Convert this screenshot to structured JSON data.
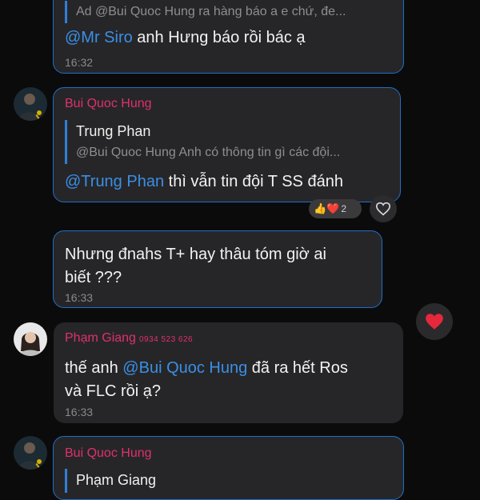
{
  "messages": [
    {
      "quote_text": "Ad @Bui Quoc Hung  ra hàng báo a e chứ, đe...",
      "mention": "@Mr Siro",
      "text": " anh Hưng báo rồi bác ạ",
      "time": "16:32"
    },
    {
      "sender": "Bui Quoc Hung",
      "quote_name": "Trung Phan",
      "quote_text": "@Bui Quoc Hung Anh có thông tin gì các đội...",
      "mention": "@Trung Phan",
      "text": " thì vẫn tin đội T SS đánh",
      "reactions": {
        "emojis": "👍❤️",
        "count": "2"
      }
    },
    {
      "line1": "Nhưng đnahs T+ hay thâu tóm giờ ai",
      "line2": "biết ???",
      "time": "16:33"
    },
    {
      "sender": "Phạm Giang",
      "phone": "0934 523 626",
      "pre": "thế anh ",
      "mention": "@Bui Quoc Hung",
      "post": " đã ra hết Ros",
      "line2": "và FLC rồi ạ?",
      "time": "16:33"
    },
    {
      "sender": "Bui Quoc Hung",
      "quote_name": "Phạm Giang"
    }
  ],
  "icons": {
    "heart_outline": "heart-outline-icon",
    "heart_reaction": "heart-reaction-icon"
  },
  "colors": {
    "background": "#0b0b0c",
    "bubble": "#262628",
    "sender": "#e0306e",
    "mention": "#3b8fe6",
    "highlight_border": "#1f6fc8"
  }
}
